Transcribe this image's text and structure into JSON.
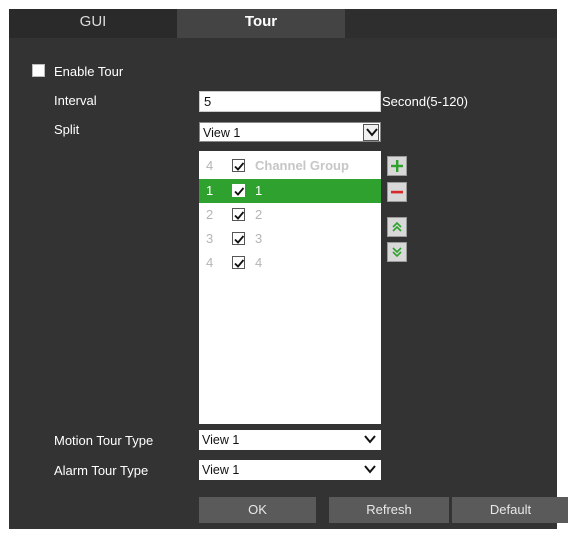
{
  "tabs": [
    {
      "label": "GUI",
      "active": false
    },
    {
      "label": "Tour",
      "active": true
    }
  ],
  "enable_tour": {
    "label": "Enable Tour",
    "checked": false
  },
  "interval": {
    "label": "Interval",
    "value": "5",
    "unit": "Second(5-120)"
  },
  "split": {
    "label": "Split",
    "value": "View 1"
  },
  "channel_list": {
    "header": {
      "index": "4",
      "checked": true,
      "name": "Channel Group"
    },
    "rows": [
      {
        "index": "1",
        "checked": true,
        "name": "1",
        "selected": true
      },
      {
        "index": "2",
        "checked": true,
        "name": "2",
        "selected": false
      },
      {
        "index": "3",
        "checked": true,
        "name": "3",
        "selected": false
      },
      {
        "index": "4",
        "checked": true,
        "name": "4",
        "selected": false
      }
    ]
  },
  "side_buttons": [
    "plus-icon",
    "minus-icon",
    "move-up-icon",
    "move-down-icon"
  ],
  "motion_tour_type": {
    "label": "Motion Tour Type",
    "value": "View 1"
  },
  "alarm_tour_type": {
    "label": "Alarm Tour Type",
    "value": "View 1"
  },
  "buttons": {
    "ok": "OK",
    "refresh": "Refresh",
    "default": "Default"
  },
  "colors": {
    "background": "#333333",
    "selected_row": "#2ea12e",
    "plus": "#2ea12e",
    "minus": "#d62a2a"
  }
}
